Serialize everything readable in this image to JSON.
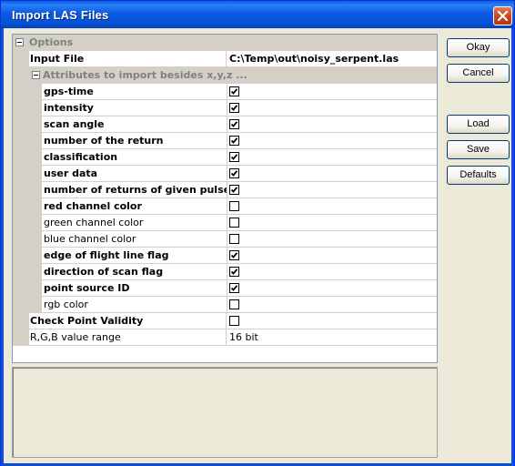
{
  "window": {
    "title": "Import LAS Files"
  },
  "grid": {
    "options_label": "Options",
    "input_file_label": "Input File",
    "input_file_value": "C:\\Temp\\out\\noisy_serpent.las",
    "attributes_label": "Attributes to import besides x,y,z ...",
    "attributes": [
      {
        "label": "gps-time",
        "checked": true,
        "bold": true
      },
      {
        "label": "intensity",
        "checked": true,
        "bold": true
      },
      {
        "label": "scan angle",
        "checked": true,
        "bold": true
      },
      {
        "label": "number of the return",
        "checked": true,
        "bold": true
      },
      {
        "label": "classification",
        "checked": true,
        "bold": true
      },
      {
        "label": "user data",
        "checked": true,
        "bold": true
      },
      {
        "label": "number of returns of given pulse",
        "checked": true,
        "bold": true
      },
      {
        "label": "red channel color",
        "checked": false,
        "bold": true
      },
      {
        "label": "green channel color",
        "checked": false,
        "bold": false
      },
      {
        "label": "blue channel color",
        "checked": false,
        "bold": false
      },
      {
        "label": "edge of flight line flag",
        "checked": true,
        "bold": true
      },
      {
        "label": "direction of scan flag",
        "checked": true,
        "bold": true
      },
      {
        "label": "point source ID",
        "checked": true,
        "bold": true
      },
      {
        "label": "rgb color",
        "checked": false,
        "bold": false
      }
    ],
    "check_validity_label": "Check Point Validity",
    "check_validity_checked": false,
    "rgb_range_label": "R,G,B value range",
    "rgb_range_value": "16 bit"
  },
  "buttons": {
    "okay": "Okay",
    "cancel": "Cancel",
    "load": "Load",
    "save": "Save",
    "defaults": "Defaults"
  },
  "colors": {
    "titlebar": "#0a5fe6",
    "dialog_bg": "#ece9d8",
    "grid_line": "#d4d0c8",
    "category_text": "#808080"
  }
}
